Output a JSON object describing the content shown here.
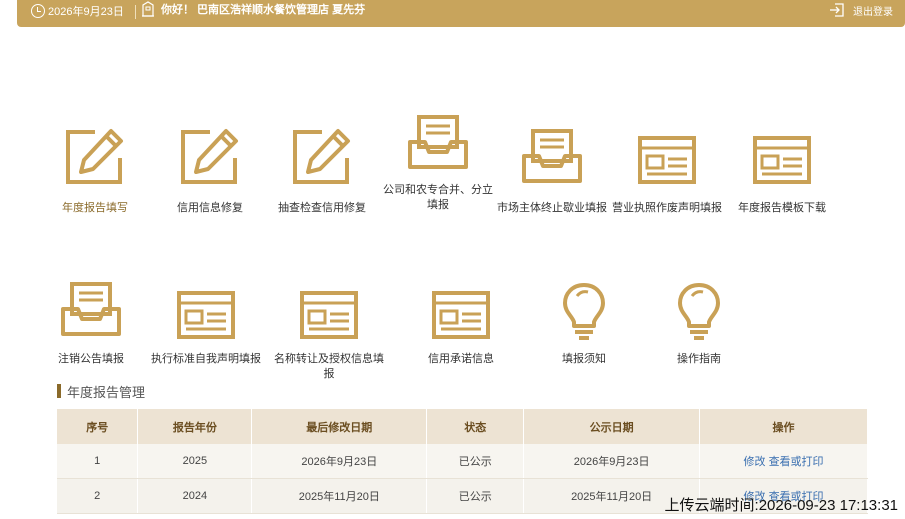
{
  "header": {
    "date": "2026年9月23日",
    "greeting": "你好！ 巴南区浩祥顺水餐饮管理店   夏先芬",
    "logout": "退出登录"
  },
  "tiles_row1": [
    {
      "label": "年度报告填写",
      "icon": "pencil-edit-icon"
    },
    {
      "label": "信用信息修复",
      "icon": "pencil-edit-icon"
    },
    {
      "label": "抽查检查信用修复",
      "icon": "pencil-edit-icon"
    },
    {
      "label": "公司和农专合并、分立填报",
      "icon": "inbox-tray-icon"
    },
    {
      "label": "市场主体终止歇业填报",
      "icon": "inbox-tray-icon"
    },
    {
      "label": "营业执照作废声明填报",
      "icon": "form-window-icon"
    },
    {
      "label": "年度报告模板下载",
      "icon": "form-window-icon"
    }
  ],
  "tiles_row2": [
    {
      "label": "注销公告填报",
      "icon": "inbox-tray-icon"
    },
    {
      "label": "执行标准自我声明填报",
      "icon": "form-window-icon"
    },
    {
      "label": "名称转让及授权信息填报",
      "icon": "form-window-icon"
    },
    {
      "label": "信用承诺信息",
      "icon": "form-window-icon"
    },
    {
      "label": "填报须知",
      "icon": "lightbulb-icon"
    },
    {
      "label": "操作指南",
      "icon": "lightbulb-icon"
    }
  ],
  "section_title": "年度报告管理",
  "table": {
    "headers": [
      "序号",
      "报告年份",
      "最后修改日期",
      "状态",
      "公示日期",
      "操作"
    ],
    "rows": [
      {
        "no": "1",
        "year": "2025",
        "modified": "2026年9月23日",
        "status": "已公示",
        "published": "2026年9月23日",
        "edit": "修改",
        "view": "查看或打印"
      },
      {
        "no": "2",
        "year": "2024",
        "modified": "2025年11月20日",
        "status": "已公示",
        "published": "2025年11月20日",
        "edit": "修改",
        "view": "查看或打印"
      }
    ]
  },
  "watermark": "上传云端时间:2026-09-23 17:13:31",
  "colors": {
    "accent": "#c8a45c",
    "icon_gold": "#c9a156",
    "dark_gold": "#8a6a2a",
    "link": "#3a6fb0"
  }
}
